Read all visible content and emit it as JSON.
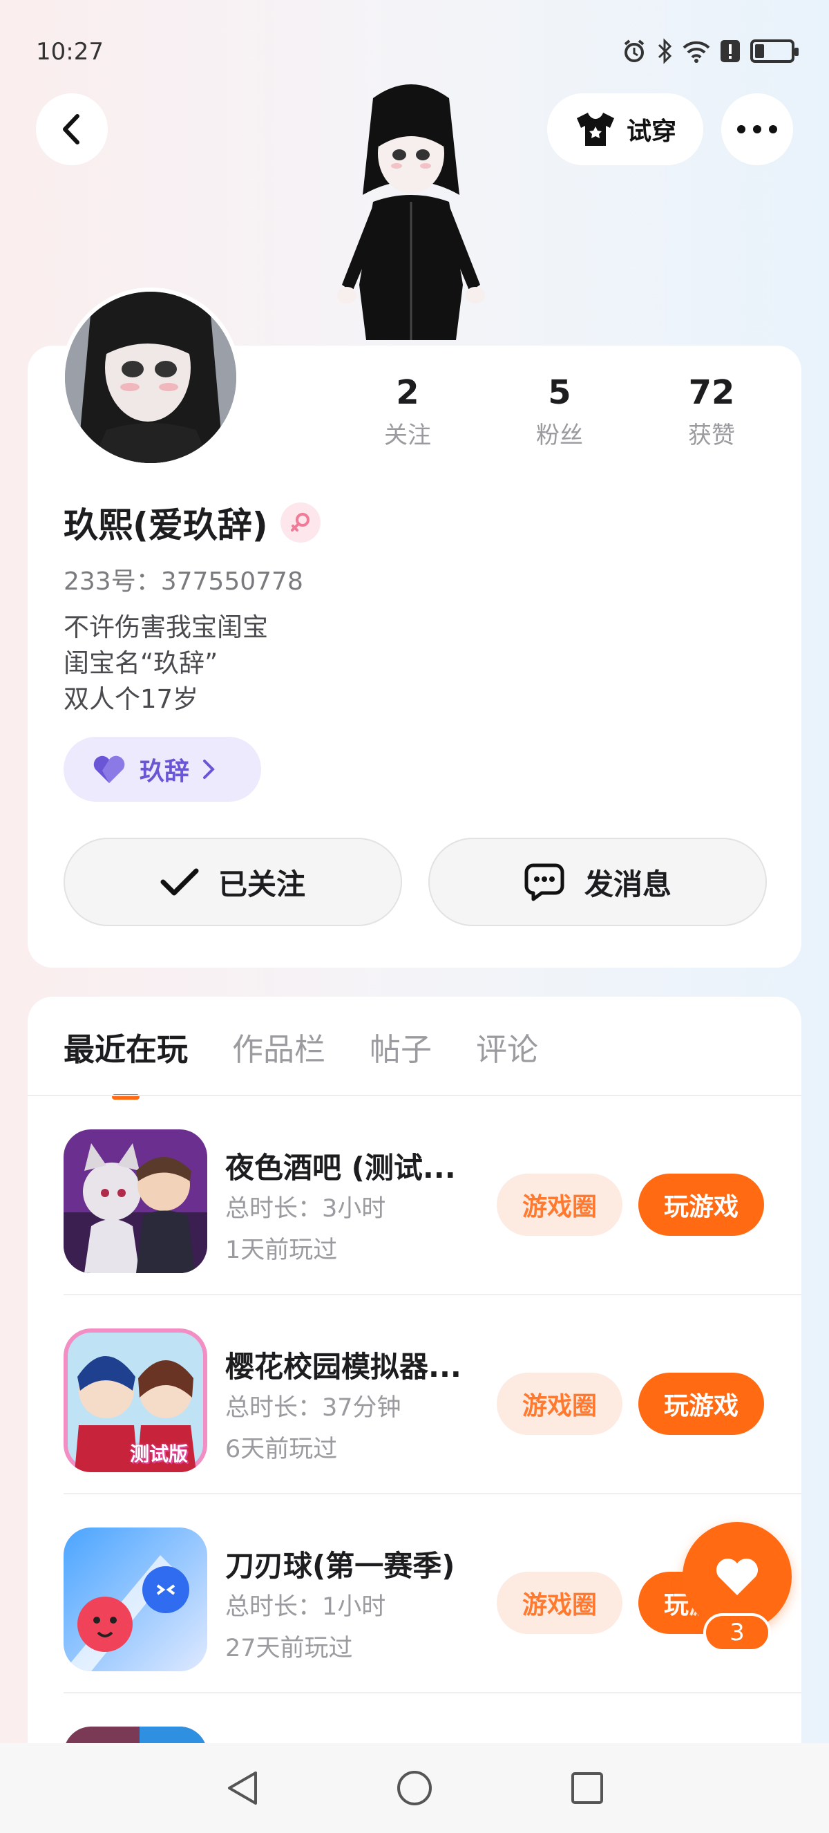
{
  "status_bar": {
    "time": "10:27",
    "icons": [
      "alarm-icon",
      "bluetooth-icon",
      "wifi-icon",
      "alert-icon",
      "battery-icon"
    ],
    "battery_level": 0.25
  },
  "top_bar": {
    "back_icon": "back-icon",
    "try_on_label": "试穿",
    "try_on_icon": "tshirt-icon",
    "more_icon": "more-icon"
  },
  "profile": {
    "stats": [
      {
        "value": "2",
        "label": "关注"
      },
      {
        "value": "5",
        "label": "粉丝"
      },
      {
        "value": "72",
        "label": "获赞"
      }
    ],
    "name": "玖熙(爱玖辞)",
    "gender_icon": "female-icon",
    "id_text": "233号：377550778",
    "bio": [
      "不许伤害我宝闺宝",
      "闺宝名“玖辞”",
      "双人个17岁"
    ],
    "cp_label": "玖辞",
    "cp_icon": "heart-icon",
    "follow_label": "已关注",
    "message_label": "发消息"
  },
  "tabs": [
    "最近在玩",
    "作品栏",
    "帖子",
    "评论"
  ],
  "active_tab": 0,
  "games": [
    {
      "title": "夜色酒吧 (测试...",
      "duration": "总时长：3小时",
      "last_played": "1天前玩过",
      "circle_label": "游戏圈",
      "play_label": "玩游戏"
    },
    {
      "title": "樱花校园模拟器...",
      "duration": "总时长：37分钟",
      "last_played": "6天前玩过",
      "circle_label": "游戏圈",
      "play_label": "玩游戏",
      "icon_text": "测试版"
    },
    {
      "title": "刀刃球(第一赛季)",
      "duration": "总时长：1小时",
      "last_played": "27天前玩过",
      "circle_label": "游戏圈",
      "play_label": "玩游戏"
    }
  ],
  "fab": {
    "icon": "heart-icon",
    "count": "3"
  },
  "colors": {
    "accent": "#ff6a13",
    "accent_light": "#fdebe2",
    "chip": "#eceafc",
    "chip_text": "#6a55d6"
  }
}
